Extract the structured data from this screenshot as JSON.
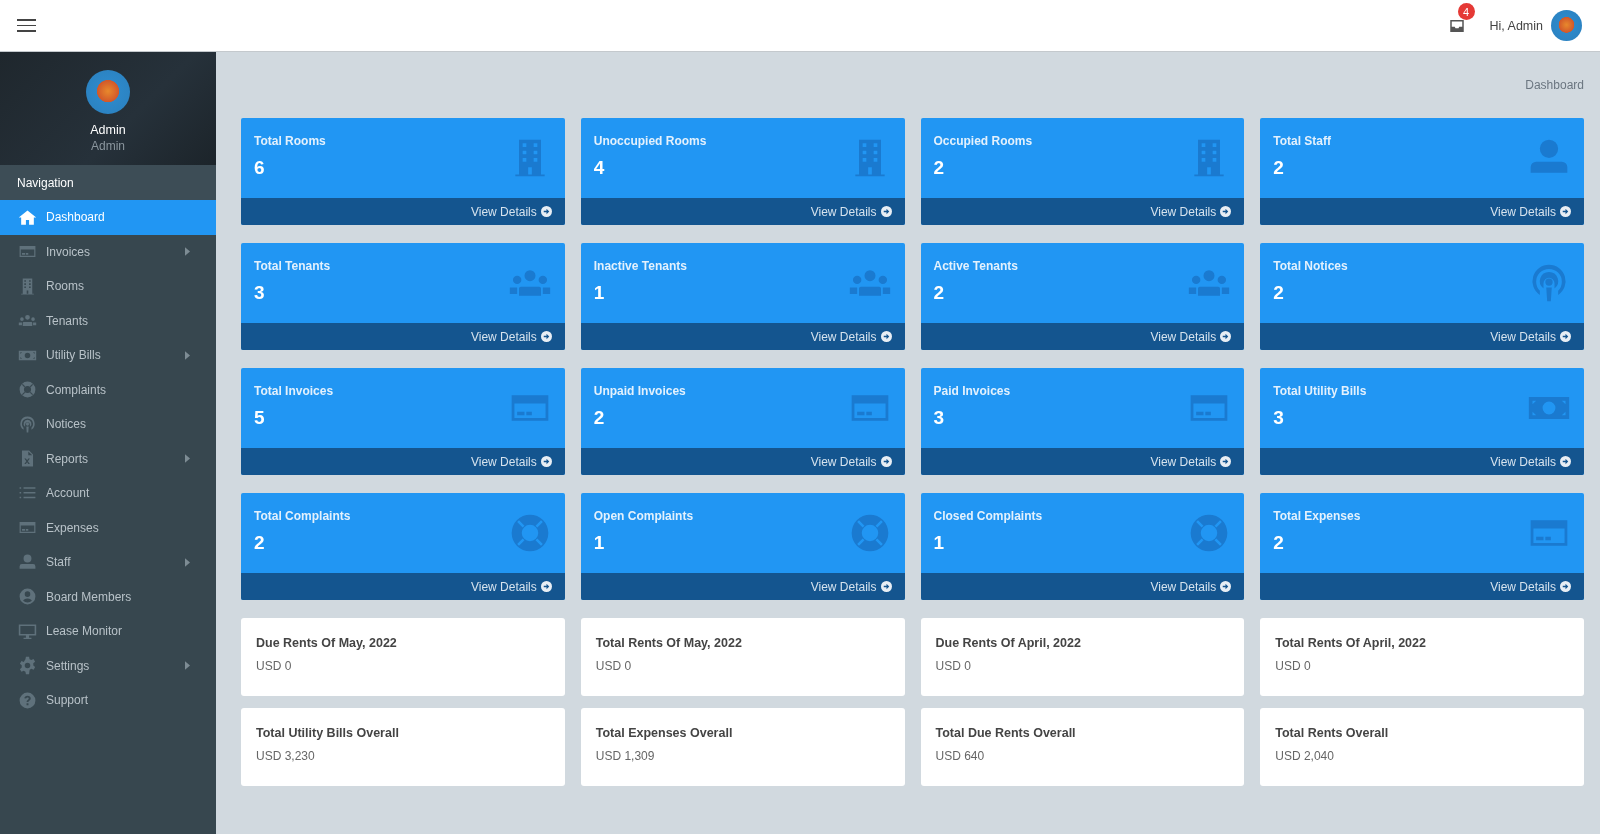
{
  "header": {
    "notification_count": "4",
    "greeting": "Hi, Admin"
  },
  "sidebar": {
    "profile": {
      "name": "Admin",
      "role": "Admin"
    },
    "section_title": "Navigation",
    "items": [
      {
        "label": "Dashboard",
        "kind": "home",
        "selected": true,
        "has_submenu": false
      },
      {
        "label": "Invoices",
        "kind": "card",
        "selected": false,
        "has_submenu": true
      },
      {
        "label": "Rooms",
        "kind": "building",
        "selected": false,
        "has_submenu": false
      },
      {
        "label": "Tenants",
        "kind": "users",
        "selected": false,
        "has_submenu": false
      },
      {
        "label": "Utility Bills",
        "kind": "money",
        "selected": false,
        "has_submenu": true
      },
      {
        "label": "Complaints",
        "kind": "lifering",
        "selected": false,
        "has_submenu": false
      },
      {
        "label": "Notices",
        "kind": "podcast",
        "selected": false,
        "has_submenu": false
      },
      {
        "label": "Reports",
        "kind": "excel",
        "selected": false,
        "has_submenu": true
      },
      {
        "label": "Account",
        "kind": "list",
        "selected": false,
        "has_submenu": false
      },
      {
        "label": "Expenses",
        "kind": "card",
        "selected": false,
        "has_submenu": false
      },
      {
        "label": "Staff",
        "kind": "user",
        "selected": false,
        "has_submenu": true
      },
      {
        "label": "Board Members",
        "kind": "usercircle",
        "selected": false,
        "has_submenu": false
      },
      {
        "label": "Lease Monitor",
        "kind": "monitor",
        "selected": false,
        "has_submenu": false
      },
      {
        "label": "Settings",
        "kind": "gear",
        "selected": false,
        "has_submenu": true
      },
      {
        "label": "Support",
        "kind": "question",
        "selected": false,
        "has_submenu": false
      }
    ]
  },
  "breadcrumb": "Dashboard",
  "stat_tiles": [
    {
      "title": "Total Rooms",
      "value": "6",
      "kind": "building",
      "link": "View Details"
    },
    {
      "title": "Unoccupied Rooms",
      "value": "4",
      "kind": "building",
      "link": "View Details"
    },
    {
      "title": "Occupied Rooms",
      "value": "2",
      "kind": "building",
      "link": "View Details"
    },
    {
      "title": "Total Staff",
      "value": "2",
      "kind": "user",
      "link": "View Details"
    },
    {
      "title": "Total Tenants",
      "value": "3",
      "kind": "users",
      "link": "View Details"
    },
    {
      "title": "Inactive Tenants",
      "value": "1",
      "kind": "users",
      "link": "View Details"
    },
    {
      "title": "Active Tenants",
      "value": "2",
      "kind": "users",
      "link": "View Details"
    },
    {
      "title": "Total Notices",
      "value": "2",
      "kind": "podcast",
      "link": "View Details"
    },
    {
      "title": "Total Invoices",
      "value": "5",
      "kind": "card",
      "link": "View Details"
    },
    {
      "title": "Unpaid Invoices",
      "value": "2",
      "kind": "card",
      "link": "View Details"
    },
    {
      "title": "Paid Invoices",
      "value": "3",
      "kind": "card",
      "link": "View Details"
    },
    {
      "title": "Total Utility Bills",
      "value": "3",
      "kind": "money",
      "link": "View Details"
    },
    {
      "title": "Total Complaints",
      "value": "2",
      "kind": "lifering",
      "link": "View Details"
    },
    {
      "title": "Open Complaints",
      "value": "1",
      "kind": "lifering",
      "link": "View Details"
    },
    {
      "title": "Closed Complaints",
      "value": "1",
      "kind": "lifering",
      "link": "View Details"
    },
    {
      "title": "Total Expenses",
      "value": "2",
      "kind": "card",
      "link": "View Details"
    }
  ],
  "summary_cards": [
    {
      "title": "Due Rents Of May, 2022",
      "amount": "USD 0"
    },
    {
      "title": "Total Rents Of May, 2022",
      "amount": "USD 0"
    },
    {
      "title": "Due Rents Of April, 2022",
      "amount": "USD 0"
    },
    {
      "title": "Total Rents Of April, 2022",
      "amount": "USD 0"
    },
    {
      "title": "Total Utility Bills Overall",
      "amount": "USD 3,230"
    },
    {
      "title": "Total Expenses Overall",
      "amount": "USD 1,309"
    },
    {
      "title": "Total Due Rents Overall",
      "amount": "USD 640"
    },
    {
      "title": "Total Rents Overall",
      "amount": "USD 2,040"
    }
  ]
}
